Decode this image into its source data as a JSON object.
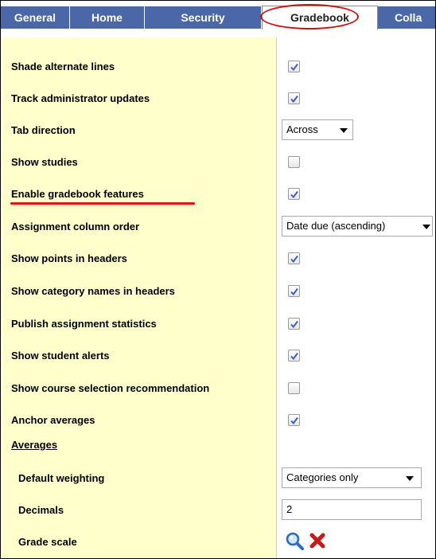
{
  "tabs": [
    {
      "label": "General",
      "active": false
    },
    {
      "label": "Home",
      "active": false
    },
    {
      "label": "Security",
      "active": false
    },
    {
      "label": "Gradebook",
      "active": true
    },
    {
      "label": "Colla",
      "active": false
    }
  ],
  "settings": [
    {
      "label": "Shade alternate lines",
      "control": "checkbox",
      "checked": true
    },
    {
      "label": "Track administrator updates",
      "control": "checkbox",
      "checked": true
    },
    {
      "label": "Tab direction",
      "control": "select",
      "value": "Across"
    },
    {
      "label": "Show studies",
      "control": "checkbox",
      "checked": false
    },
    {
      "label": "Enable gradebook features",
      "control": "checkbox",
      "checked": true
    },
    {
      "label": "Assignment column order",
      "control": "select",
      "value": "Date due (ascending)"
    },
    {
      "label": "Show points in headers",
      "control": "checkbox",
      "checked": true
    },
    {
      "label": "Show category names in headers",
      "control": "checkbox",
      "checked": true
    },
    {
      "label": "Publish assignment statistics",
      "control": "checkbox",
      "checked": true
    },
    {
      "label": "Show student alerts",
      "control": "checkbox",
      "checked": true
    },
    {
      "label": "Show course selection recommendation",
      "control": "checkbox",
      "checked": false
    },
    {
      "label": "Anchor averages",
      "control": "checkbox",
      "checked": true
    }
  ],
  "averages": {
    "heading": "Averages",
    "default_weighting": {
      "label": "Default weighting",
      "value": "Categories only"
    },
    "decimals": {
      "label": "Decimals",
      "value": "2"
    },
    "grade_scale": {
      "label": "Grade scale",
      "icons": [
        "magnifier-icon",
        "delete-x-icon"
      ]
    }
  },
  "colors": {
    "tab_bg": "#4a68a8",
    "label_bg": "#ffffcc",
    "highlight_red": "#e01515"
  }
}
